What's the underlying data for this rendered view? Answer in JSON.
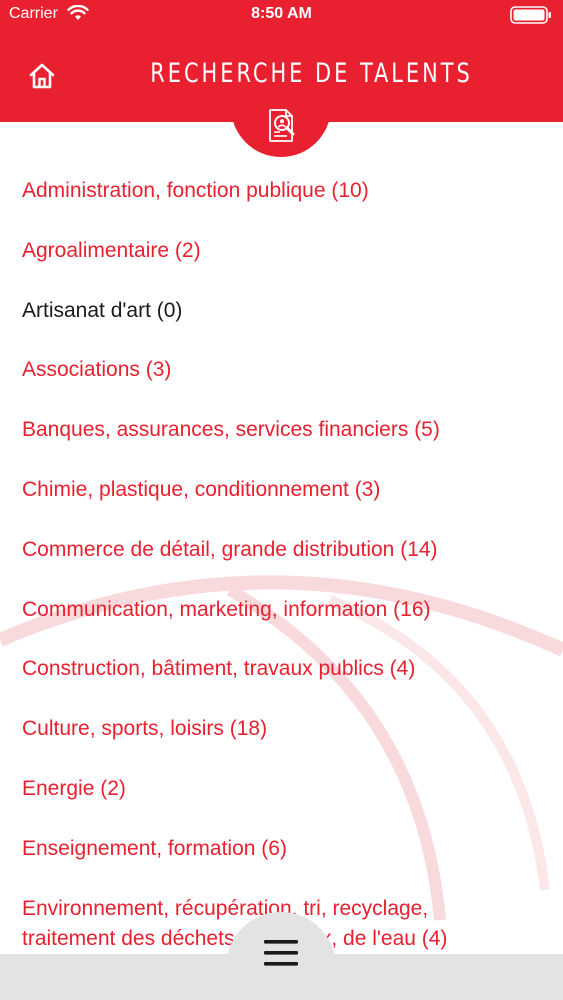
{
  "status_bar": {
    "carrier": "Carrier",
    "time": "8:50 AM"
  },
  "header": {
    "title": "RECHERCHE DE TALENTS",
    "home_icon": "home-icon",
    "badge_icon": "talent-search-icon"
  },
  "categories": [
    {
      "label": "Administration, fonction publique (10)",
      "enabled": true
    },
    {
      "label": "Agroalimentaire (2)",
      "enabled": true
    },
    {
      "label": "Artisanat d'art (0)",
      "enabled": false
    },
    {
      "label": "Associations (3)",
      "enabled": true
    },
    {
      "label": "Banques, assurances, services financiers (5)",
      "enabled": true
    },
    {
      "label": "Chimie, plastique, conditionnement (3)",
      "enabled": true
    },
    {
      "label": "Commerce de détail, grande distribution (14)",
      "enabled": true
    },
    {
      "label": "Communication, marketing, information (16)",
      "enabled": true
    },
    {
      "label": "Construction, bâtiment, travaux publics (4)",
      "enabled": true
    },
    {
      "label": "Culture, sports, loisirs (18)",
      "enabled": true
    },
    {
      "label": "Energie (2)",
      "enabled": true
    },
    {
      "label": "Enseignement, formation (6)",
      "enabled": true
    },
    {
      "label": "Environnement, récupération, tri, recyclage, traitement des déchets, des eaux, de l'eau (4)",
      "enabled": true
    }
  ],
  "bottom": {
    "menu_icon": "hamburger-menu-icon"
  },
  "colors": {
    "accent": "#e8202f",
    "disabled_text": "#1a1a1a",
    "bottom_bar": "#e3e3e3"
  }
}
